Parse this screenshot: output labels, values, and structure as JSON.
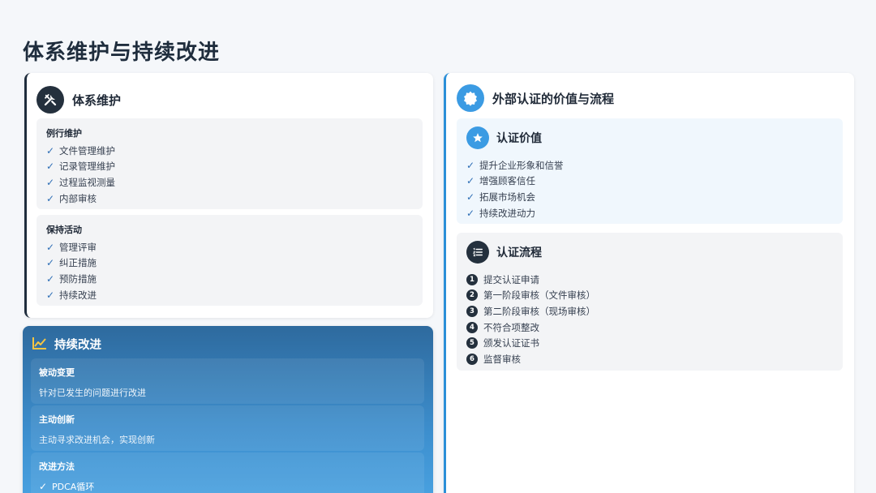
{
  "page": {
    "title": "体系维护与持续改进"
  },
  "maintenance": {
    "title": "体系维护",
    "icon": "tools-icon",
    "routine": {
      "title": "例行维护",
      "items": [
        "文件管理维护",
        "记录管理维护",
        "过程监视测量",
        "内部审核"
      ]
    },
    "keeping": {
      "title": "保持活动",
      "items": [
        "管理评审",
        "纠正措施",
        "预防措施",
        "持续改进"
      ]
    }
  },
  "improvement": {
    "title": "持续改进",
    "icon": "line-chart-icon",
    "passive": {
      "title": "被动变更",
      "text": "针对已发生的问题进行改进"
    },
    "active": {
      "title": "主动创新",
      "text": "主动寻求改进机会，实现创新"
    },
    "methods": {
      "title": "改进方法",
      "items": [
        "PDCA循环"
      ]
    }
  },
  "certification": {
    "title": "外部认证的价值与流程",
    "icon": "badge-certificate-icon",
    "value": {
      "title": "认证价值",
      "icon": "star-icon",
      "items": [
        "提升企业形象和信誉",
        "增强顾客信任",
        "拓展市场机会",
        "持续改进动力"
      ]
    },
    "process": {
      "title": "认证流程",
      "icon": "list-ordered-icon",
      "steps": [
        {
          "num": "1",
          "label": "提交认证申请"
        },
        {
          "num": "2",
          "label": "第一阶段审核（文件审核）"
        },
        {
          "num": "3",
          "label": "第二阶段审核（现场审核）"
        },
        {
          "num": "4",
          "label": "不符合项整改"
        },
        {
          "num": "5",
          "label": "颁发认证证书"
        },
        {
          "num": "6",
          "label": "监督审核"
        }
      ]
    }
  },
  "colors": {
    "dark": "#24303d",
    "accent": "#3b9be3",
    "check": "#2f6fb6"
  }
}
